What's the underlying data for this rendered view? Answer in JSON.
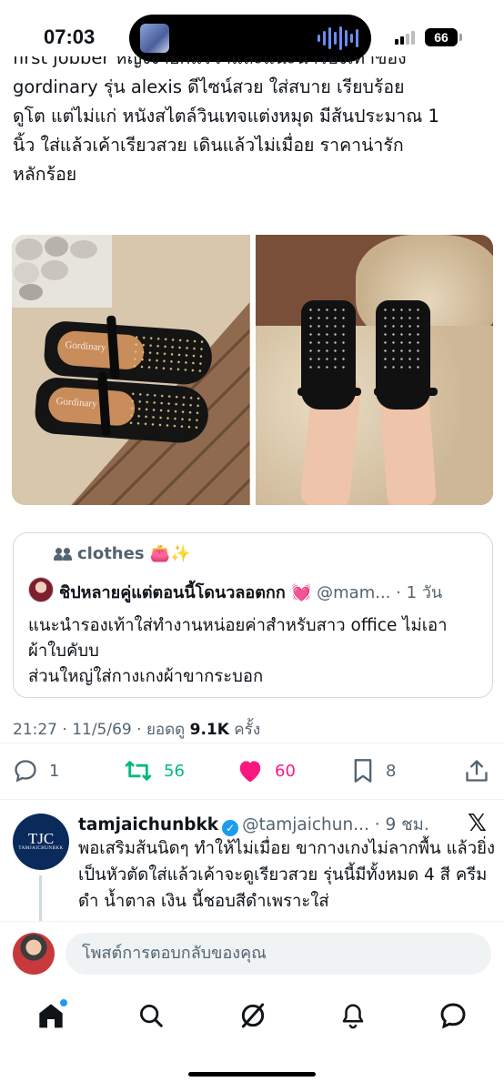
{
  "status_bar": {
    "time": "07:03",
    "battery": "66"
  },
  "tweet": {
    "lines": [
      "first jobber หญิงง่ายกแร้วาและแนะนำรองเท้าของ",
      "gordinary รุ่น alexis ดีไซน์สวย ใส่สบาย เรียบร้อย",
      "ดูโต แต่ไม่แก่ หนังสไตล์วินเทจแต่งหมุด มีส้นประมาณ 1",
      "นิ้ว ใส่แล้วเค้าเรียวสวย เดินแล้วไม่เมื่อย ราคาน่ารัก",
      "หลักร้อย"
    ],
    "brand_on_insole": "Gordinary",
    "timestamp": "21:27 · 11/5/69 · ยอดดู ",
    "views": "9.1K",
    "views_suffix": " ครั้ง"
  },
  "quote": {
    "community": "clothes 👛✨",
    "name": "ชิปหลายคู่แต่ตอนนี้โดนวลอตกก 💓",
    "handle": " @mam... · 1 วัน",
    "body_line1": "แนะนำรองเท้าใส่ทำงานหน่อยค่าสำหรับสาว office ไม่เอา",
    "body_line2": "ผ้าใบคับบ",
    "body_line3": "ส่วนใหญ่ใส่กางเกงผ้าขากระบอก"
  },
  "actions": {
    "replies": "1",
    "reposts": "56",
    "likes": "60",
    "bookmarks": "8"
  },
  "reply_tweet": {
    "avatar_text": "TJC",
    "avatar_sub": "TAMJAICHUNBKK",
    "name": "tamjaichunbkk",
    "handle": "@tamjaichun... · 9 ชม.",
    "body": "พอเสริมส้นนิดๆ ทำให้ไม่เมื่อย ขากางเกงไม่ลากพื้น แล้วยิ่งเป็นหัวตัดใส่แล้วเค้าจะดูเรียวสวย รุ่นนี้มีทั้งหมด 4 สี ครีม ดำ น้ำตาล เงิน นี้ชอบสีดำเพราะใส่"
  },
  "reply_bar": {
    "placeholder": "โพสต์การตอบกลับของคุณ"
  },
  "colors": {
    "text": "#0f1419",
    "secondary": "#536471",
    "repost_green": "#00ba7c",
    "like_pink": "#f91880",
    "verified_blue": "#1d9bf0"
  }
}
